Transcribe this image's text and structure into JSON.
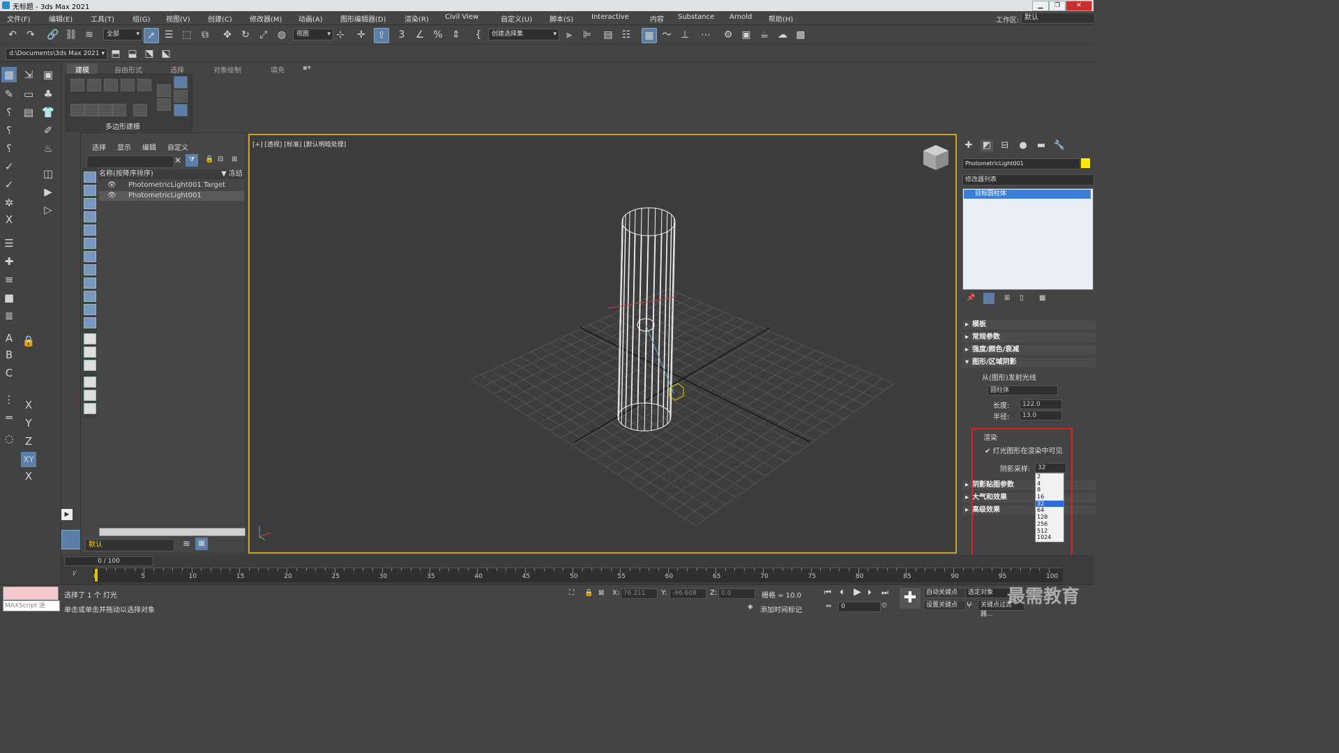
{
  "window": {
    "title": "无标题 - 3ds Max 2021"
  },
  "menu": [
    "文件(F)",
    "编辑(E)",
    "工具(T)",
    "组(G)",
    "视图(V)",
    "创建(C)",
    "修改器(M)",
    "动画(A)",
    "图形编辑器(D)",
    "渲染(R)",
    "Civil View",
    "自定义(U)",
    "脚本(S)",
    "Interactive",
    "内容",
    "Substance",
    "Arnold",
    "帮助(H)"
  ],
  "workspace": {
    "label": "工作区:",
    "value": "默认"
  },
  "toolbar": {
    "filter": "全部",
    "coord": "视图",
    "selset": "创建选择集"
  },
  "project_path": "d:\\Documents\\3ds Max 2021",
  "ribbon": {
    "tabs": [
      "建模",
      "自由形式",
      "选择",
      "对象绘制",
      "填充"
    ],
    "panel": "多边形建模"
  },
  "explorer": {
    "menu": [
      "选择",
      "显示",
      "编辑",
      "自定义"
    ],
    "header": "名称(按降序排序)",
    "freeze": "▼ 冻结",
    "rows": [
      "PhotometricLight001.Target",
      "PhotometricLight001"
    ],
    "layer": "默认"
  },
  "viewport": {
    "label": "[+] [透视] [标准] [默认明暗处理]"
  },
  "cmdpanel": {
    "object_name": "PhotometricLight001",
    "modifier_list": "修改器列表",
    "stack_item": "目标圆柱体",
    "rollouts": [
      "模板",
      "常规参数",
      "强度/颜色/衰减",
      "图形/区域阴影"
    ],
    "emit_label": "从(图形)发射光线",
    "shape": "圆柱体",
    "length_label": "长度:",
    "length_val": "122.0",
    "radius_label": "半径:",
    "radius_val": "13.0",
    "render_group": "渲染",
    "visible_check": "✔ 灯光图形在渲染中可见",
    "shadow_label": "阴影采样:",
    "shadow_val": "32",
    "rollouts2": [
      "阴影贴图参数",
      "大气和效果",
      "高级效果"
    ],
    "dropdown": [
      "2",
      "4",
      "8",
      "16",
      "32",
      "64",
      "128",
      "256",
      "512",
      "1024"
    ]
  },
  "timeline": {
    "frame": "0 / 100",
    "ticks": [
      "0",
      "5",
      "10",
      "15",
      "20",
      "25",
      "30",
      "35",
      "40",
      "45",
      "50",
      "55",
      "60",
      "65",
      "70",
      "75",
      "80",
      "85",
      "90",
      "95",
      "100"
    ]
  },
  "status": {
    "maxscript": "MAXScript 迷",
    "selected": "选择了 1 个 灯光",
    "hint": "单击或单击并拖动以选择对象",
    "x": "76.211",
    "y": "-96.608",
    "z": "0.0",
    "grid": "栅格 = 10.0",
    "add_time_tag": "添加时间标记",
    "auto_key": "自动关键点",
    "set_key": "设置关键点",
    "selected_obj": "选定对象",
    "key_filter": "关键点过滤器...",
    "frame_val": "0",
    "watermark": "最需教育"
  }
}
